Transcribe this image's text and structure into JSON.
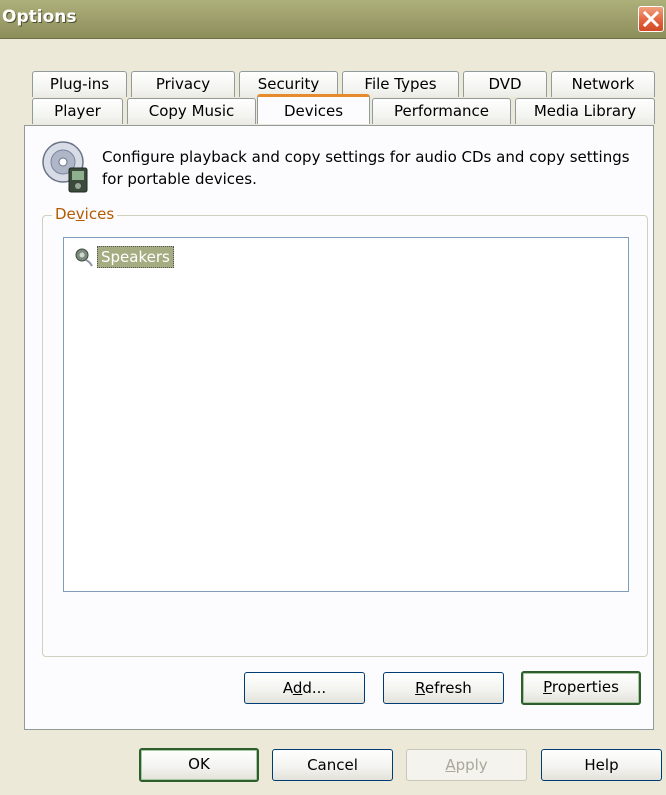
{
  "window": {
    "title": "Options"
  },
  "tabs": {
    "row1": [
      "Plug-ins",
      "Privacy",
      "Security",
      "File Types",
      "DVD",
      "Network"
    ],
    "row2": [
      "Player",
      "Copy Music",
      "Devices",
      "Performance",
      "Media Library"
    ],
    "active": "Devices"
  },
  "devices_tab": {
    "description": "Configure playback and copy settings for audio CDs and copy settings for portable devices.",
    "group_label_pre": "De",
    "group_label_key": "v",
    "group_label_post": "ices",
    "list_items": [
      "Speakers"
    ],
    "buttons": {
      "add_pre": "A",
      "add_key": "d",
      "add_post": "d...",
      "refresh_key": "R",
      "refresh_post": "efresh",
      "properties_key": "P",
      "properties_post": "roperties"
    }
  },
  "dialog_buttons": {
    "ok": "OK",
    "cancel": "Cancel",
    "apply_key": "A",
    "apply_post": "pply",
    "help": "Help"
  }
}
